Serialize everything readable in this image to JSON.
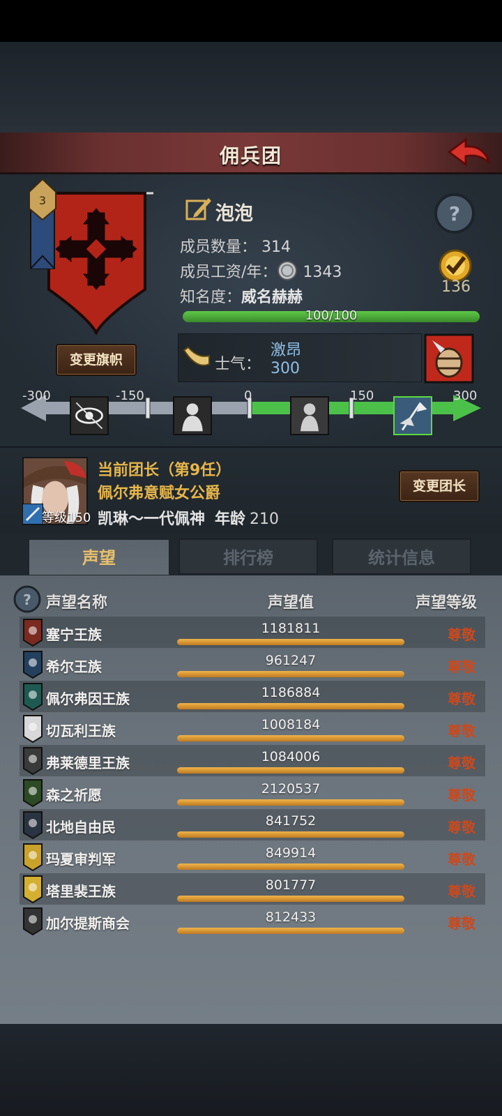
{
  "header": {
    "title": "佣兵团"
  },
  "company": {
    "name": "泡泡",
    "change_flag_label": "变更旗帜",
    "banner_level": "3",
    "members": {
      "label": "成员数量：",
      "value": "314"
    },
    "wages": {
      "label": "成员工资/年：",
      "value": "1343"
    },
    "fame": {
      "label": "知名度：",
      "value": "威名赫赫",
      "progress_text": "100/100",
      "progress": 1.0
    },
    "trophy_count": "136",
    "morale": {
      "label": "士气：",
      "state": "激昂",
      "value": "300"
    }
  },
  "morale_scale": {
    "ticks": [
      "-300",
      "-150",
      "0",
      "150",
      "300"
    ],
    "current": 300,
    "range": [
      -300,
      300
    ]
  },
  "leader": {
    "line1": "当前团长（第9任）",
    "line2": "佩尔弗意赋女公爵",
    "name": "凯琳～一代佩神",
    "age_label": "年龄",
    "age": "210",
    "level_text": "等级150",
    "change_label": "变更团长"
  },
  "tabs": [
    {
      "label": "声望",
      "active": true
    },
    {
      "label": "排行榜",
      "active": false
    },
    {
      "label": "统计信息",
      "active": false
    }
  ],
  "table": {
    "headers": {
      "name": "声望名称",
      "value": "声望值",
      "level": "声望等级"
    },
    "rows": [
      {
        "name": "塞宁王族",
        "value": "1181811",
        "level": "尊敬",
        "icon": "red-crest-icon",
        "color": "#7a2a20"
      },
      {
        "name": "希尔王族",
        "value": "961247",
        "level": "尊敬",
        "icon": "blue-helm-icon",
        "color": "#24405e"
      },
      {
        "name": "佩尔弗因王族",
        "value": "1186884",
        "level": "尊敬",
        "icon": "teal-moon-icon",
        "color": "#1e5a52"
      },
      {
        "name": "切瓦利王族",
        "value": "1008184",
        "level": "尊敬",
        "icon": "scales-icon",
        "color": "#d8d8d8"
      },
      {
        "name": "弗莱德里王族",
        "value": "1084006",
        "level": "尊敬",
        "icon": "skull-face-icon",
        "color": "#3a3a3a"
      },
      {
        "name": "森之祈愿",
        "value": "2120537",
        "level": "尊敬",
        "icon": "tree-icon",
        "color": "#2c4a24"
      },
      {
        "name": "北地自由民",
        "value": "841752",
        "level": "尊敬",
        "icon": "axe-icon",
        "color": "#2a3440"
      },
      {
        "name": "玛夏审判军",
        "value": "849914",
        "level": "尊敬",
        "icon": "gold-chevron-icon",
        "color": "#c9a22a"
      },
      {
        "name": "塔里裴王族",
        "value": "801777",
        "level": "尊敬",
        "icon": "gold-crown-icon",
        "color": "#d4b030"
      },
      {
        "name": "加尔提斯商会",
        "value": "812433",
        "level": "尊敬",
        "icon": "chest-icon",
        "color": "#333333"
      }
    ]
  },
  "colors": {
    "accent_gold": "#e7b64a",
    "morale_blue": "#8fc0e8",
    "fame_green": "#5ec947",
    "level_red": "#c84a20"
  }
}
